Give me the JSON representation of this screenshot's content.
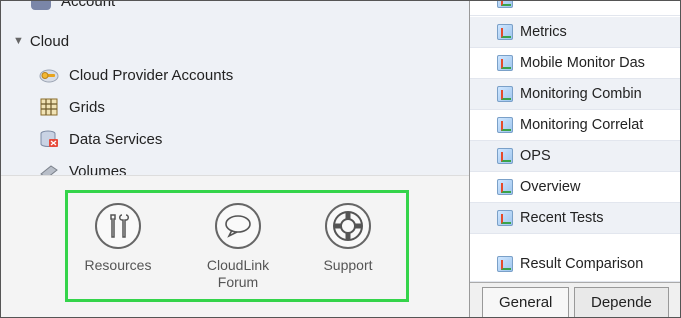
{
  "tree": {
    "partial_top_label": "Account",
    "cloud_label": "Cloud",
    "items": [
      {
        "label": "Cloud Provider Accounts",
        "icon": "cloud-key-icon"
      },
      {
        "label": "Grids",
        "icon": "grid-icon"
      },
      {
        "label": "Data Services",
        "icon": "database-icon"
      },
      {
        "label": "Volumes",
        "icon": "volume-icon"
      }
    ]
  },
  "tools": [
    {
      "label": "Resources",
      "icon": "tools-icon"
    },
    {
      "label": "CloudLink Forum",
      "icon": "speech-bubble-icon"
    },
    {
      "label": "Support",
      "icon": "lifebuoy-icon"
    }
  ],
  "list": {
    "items": [
      "Metrics",
      "Mobile Monitor Das",
      "Monitoring Combin",
      "Monitoring Correlat",
      "OPS",
      "Overview",
      "Recent Tests",
      "Result Comparison"
    ]
  },
  "tabs": [
    "General",
    "Depende"
  ],
  "colors": {
    "highlight_border": "#34d44a",
    "tree_bg": "#eef1f6"
  }
}
